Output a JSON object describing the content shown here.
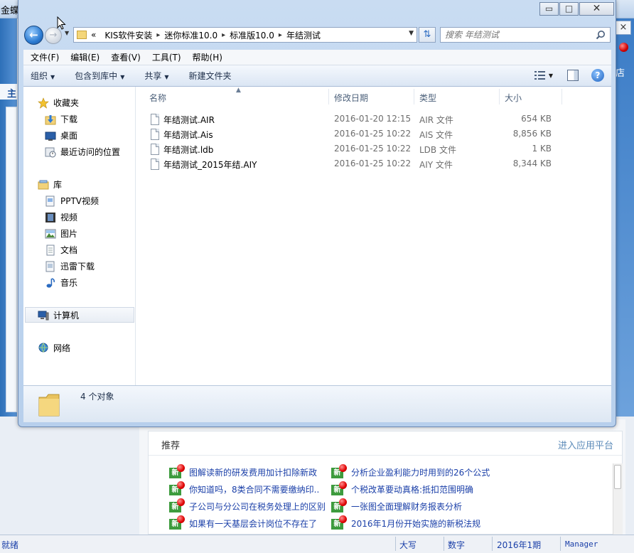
{
  "background_app": {
    "title": "金蝶",
    "left_tab": "主",
    "right_store_label": "店",
    "close_glyph": "×",
    "recommend": {
      "title": "推荐",
      "link": "进入应用平台",
      "badge": "新",
      "col1": [
        "图解读新的研发费用加计扣除新政",
        "你知道吗，8类合同不需要缴纳印..",
        "子公司与分公司在税务处理上的区别",
        "如果有一天基层会计岗位不存在了"
      ],
      "col2": [
        "分析企业盈利能力时用到的26个公式",
        "个税改革要动真格:抵扣范围明确",
        "一张图全面理解财务报表分析",
        "2016年1月份开始实施的新税法规"
      ]
    },
    "status": {
      "ready": "就绪",
      "caps": "大写",
      "num": "数字",
      "period": "2016年1期",
      "user": "Manager"
    }
  },
  "explorer": {
    "controls": {
      "minimize": "▭",
      "maximize": "□",
      "close": "✕"
    },
    "address": {
      "overflow": "«",
      "crumbs": [
        "KIS软件安装",
        "迷你标准10.0",
        "标准版10.0",
        "年结测试"
      ]
    },
    "search": {
      "placeholder": "搜索 年结测试"
    },
    "menu": [
      "文件(F)",
      "编辑(E)",
      "查看(V)",
      "工具(T)",
      "帮助(H)"
    ],
    "toolbar": {
      "organize": "组织",
      "include_library": "包含到库中",
      "share": "共享",
      "new_folder": "新建文件夹"
    },
    "nav": {
      "favorites": "收藏夹",
      "downloads": "下载",
      "desktop": "桌面",
      "recent": "最近访问的位置",
      "library": "库",
      "pptv": "PPTV视频",
      "videos": "视频",
      "pictures": "图片",
      "documents": "文档",
      "thunder": "迅雷下载",
      "music": "音乐",
      "computer": "计算机",
      "network": "网络"
    },
    "columns": {
      "name": "名称",
      "date": "修改日期",
      "type": "类型",
      "size": "大小"
    },
    "files": [
      {
        "name": "年结测试.AIR",
        "date": "2016-01-20 12:15",
        "type": "AIR 文件",
        "size": "654 KB"
      },
      {
        "name": "年结测试.Ais",
        "date": "2016-01-25 10:22",
        "type": "AIS 文件",
        "size": "8,856 KB"
      },
      {
        "name": "年结测试.ldb",
        "date": "2016-01-25 10:22",
        "type": "LDB 文件",
        "size": "1 KB"
      },
      {
        "name": "年结测试_2015年结.AIY",
        "date": "2016-01-25 10:22",
        "type": "AIY 文件",
        "size": "8,344 KB"
      }
    ],
    "details": {
      "count": "4 个对象"
    }
  }
}
